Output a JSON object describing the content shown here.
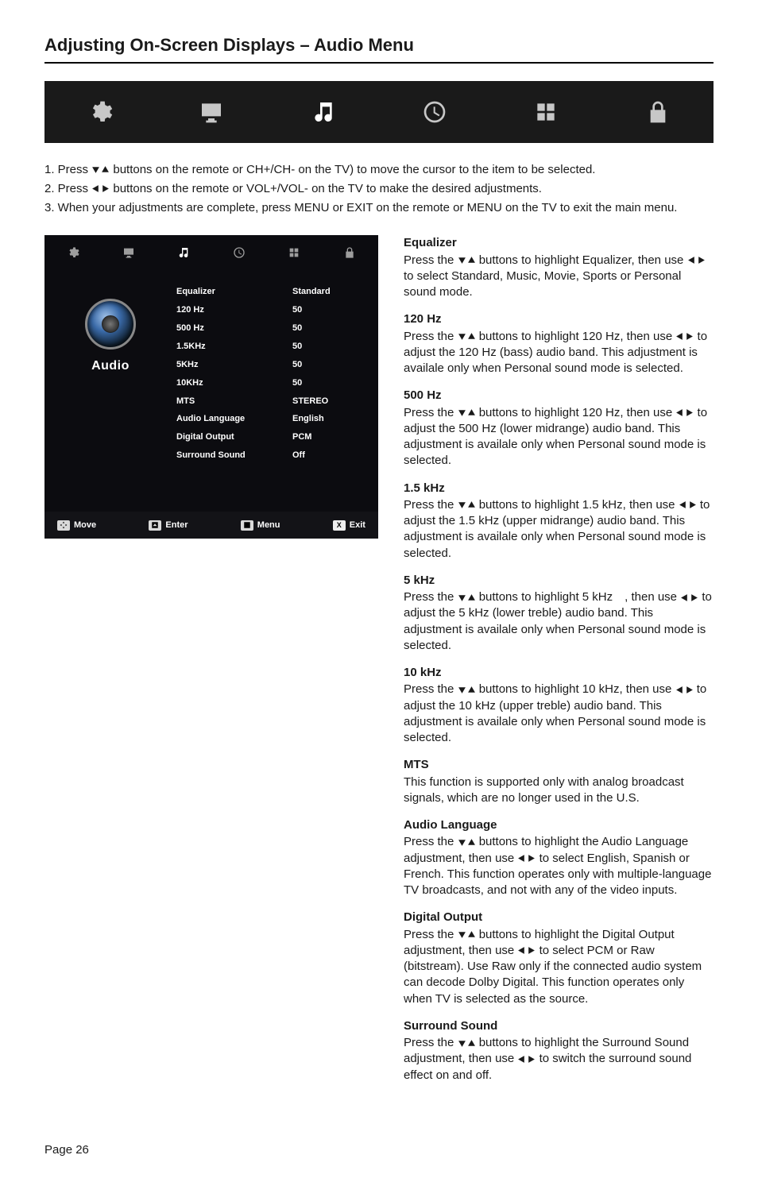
{
  "page": {
    "title": "Adjusting On-Screen Displays – Audio Menu",
    "footer": "Page 26"
  },
  "topIcons": [
    "settings",
    "monitor",
    "music",
    "clock",
    "grid",
    "lock"
  ],
  "steps": {
    "s1a": "1. Press ",
    "s1b": " buttons on the remote or CH+/CH- on the TV) to move the cursor to the item to be selected.",
    "s2a": "2. Press ",
    "s2b": " buttons on the remote or VOL+/VOL- on the TV to make the desired adjustments.",
    "s3": "3. When your adjustments are complete, press MENU or EXIT on the remote or MENU on the TV to exit the main menu."
  },
  "osd": {
    "sideLabel": "Audio",
    "rows": [
      {
        "label": "Equalizer",
        "value": "Standard"
      },
      {
        "label": "120 Hz",
        "value": "50"
      },
      {
        "label": "500 Hz",
        "value": "50"
      },
      {
        "label": "1.5KHz",
        "value": "50"
      },
      {
        "label": "5KHz",
        "value": "50"
      },
      {
        "label": "10KHz",
        "value": "50"
      },
      {
        "label": "MTS",
        "value": "STEREO"
      },
      {
        "label": "Audio Language",
        "value": "English"
      },
      {
        "label": "Digital Output",
        "value": "PCM"
      },
      {
        "label": "Surround Sound",
        "value": "Off"
      }
    ],
    "footer": {
      "move": "Move",
      "enter": "Enter",
      "menu": "Menu",
      "exitKey": "X",
      "exit": "Exit"
    }
  },
  "sections": [
    {
      "title": "Equalizer",
      "pre": "Press the ",
      "mid": " buttons to highlight Equalizer, then use ",
      "post": " to select Standard, Music, Movie, Sports or Personal sound mode.",
      "arrows1": "du",
      "arrows2": "lr"
    },
    {
      "title": "120 Hz",
      "pre": "Press the ",
      "mid": " buttons to highlight 120 Hz, then use ",
      "post": " to adjust the 120 Hz (bass) audio band. This adjustment is availale only when Personal sound mode is selected.",
      "arrows1": "du",
      "arrows2": "lr"
    },
    {
      "title": "500 Hz",
      "pre": "Press the ",
      "mid": " buttons to highlight 120 Hz, then use ",
      "post": " to adjust the 500 Hz (lower midrange) audio band. This adjustment is availale only when Personal sound mode is selected.",
      "arrows1": "du",
      "arrows2": "lr"
    },
    {
      "title": "1.5 kHz",
      "pre": "Press the ",
      "mid": " buttons to highlight 1.5 kHz, then use ",
      "post": " to adjust the 1.5 kHz (upper midrange) audio band. This adjustment is availale only when Personal sound mode is selected.",
      "arrows1": "du",
      "arrows2": "lr"
    },
    {
      "title": "5 kHz",
      "pre": "Press the ",
      "mid": " buttons to highlight 5 kHz , then use ",
      "post": " to adjust the 5 kHz (lower treble) audio band. This adjustment is availale only when Personal sound mode is selected.",
      "arrows1": "du",
      "arrows2": "lr"
    },
    {
      "title": "10 kHz",
      "pre": "Press the ",
      "mid": " buttons to highlight 10 kHz, then use ",
      "post": " to adjust the 10 kHz (upper treble) audio band. This adjustment is availale only when Personal sound mode is selected.",
      "arrows1": "du",
      "arrows2": "lr"
    },
    {
      "title": "MTS",
      "plain": "This function is supported only with analog broadcast signals, which are no longer used in the U.S."
    },
    {
      "title": "Audio Language",
      "pre": "Press the ",
      "mid": " buttons to highlight the Audio Language adjustment, then use ",
      "post": " to select English, Spanish or French. This function operates only with multiple-language TV broadcasts, and not with any of the video inputs.",
      "arrows1": "du",
      "arrows2": "lr"
    },
    {
      "title": "Digital Output",
      "pre": "Press the ",
      "mid": " buttons to highlight the Digital Output adjustment, then use ",
      "post": " to select PCM or Raw (bitstream). Use Raw only if the connected audio system can decode Dolby Digital. This function operates only when TV is selected as the source.",
      "arrows1": "du",
      "arrows2": "lr"
    },
    {
      "title": "Surround Sound",
      "pre": "Press the ",
      "mid": " buttons to highlight the Surround Sound adjustment, then use ",
      "post": " to switch the surround sound effect on and off.",
      "arrows1": "du",
      "arrows2": "lr"
    }
  ]
}
